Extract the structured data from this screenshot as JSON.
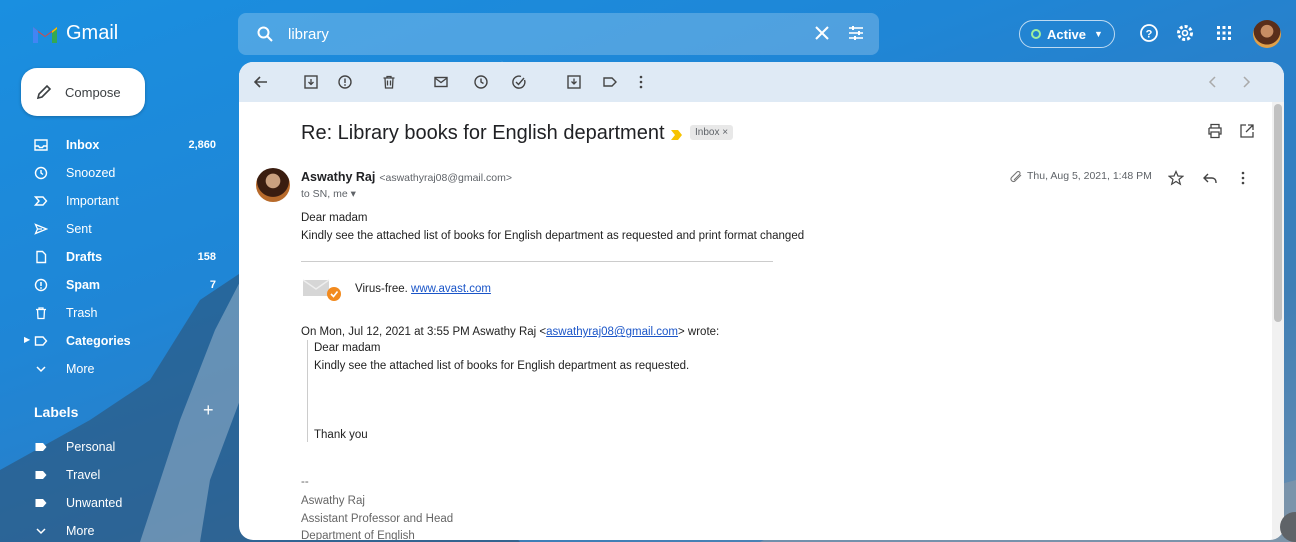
{
  "app": {
    "name": "Gmail"
  },
  "search": {
    "value": "library"
  },
  "status": {
    "label": "Active"
  },
  "compose": {
    "label": "Compose"
  },
  "sidebar": {
    "items": [
      {
        "label": "Inbox",
        "count": "2,860",
        "icon": "inbox-icon"
      },
      {
        "label": "Snoozed",
        "count": "",
        "icon": "clock-icon"
      },
      {
        "label": "Important",
        "count": "",
        "icon": "important-icon"
      },
      {
        "label": "Sent",
        "count": "",
        "icon": "send-icon"
      },
      {
        "label": "Drafts",
        "count": "158",
        "icon": "draft-icon"
      },
      {
        "label": "Spam",
        "count": "7",
        "icon": "spam-icon"
      },
      {
        "label": "Trash",
        "count": "",
        "icon": "trash-icon"
      },
      {
        "label": "Categories",
        "count": "",
        "icon": "label-icon"
      },
      {
        "label": "More",
        "count": "",
        "icon": "chevron-down-icon"
      }
    ]
  },
  "labels": {
    "heading": "Labels",
    "items": [
      {
        "label": "Personal"
      },
      {
        "label": "Travel"
      },
      {
        "label": "Unwanted"
      },
      {
        "label": "More"
      }
    ]
  },
  "email": {
    "subject": "Re: Library books for English department",
    "inbox_chip": "Inbox ×",
    "sender_name": "Aswathy Raj",
    "sender_email": "<aswathyraj08@gmail.com>",
    "to_line": "to SN, me ▾",
    "date": "Thu, Aug 5, 2021, 1:48 PM",
    "greeting": "Dear madam",
    "body": "Kindly see the attached list of books for English department as requested and print format changed",
    "virus_free": "Virus-free.",
    "avast_link": "www.avast.com",
    "quote_header_pre": "On Mon, Jul 12, 2021 at 3:55 PM Aswathy Raj <",
    "quote_header_link": "aswathyraj08@gmail.com",
    "quote_header_post": "> wrote:",
    "quote_greeting": "Dear madam",
    "quote_body": "Kindly see the attached list of books for English department as requested.",
    "quote_thanks": "Thank you",
    "sig_dash": "--",
    "sig_name": "Aswathy Raj",
    "sig_title": "Assistant Professor and Head",
    "sig_dept": "Department of English"
  },
  "colors": {
    "accent": "#1a73e8",
    "banner": "#dfeaf5",
    "link": "#1a55c8"
  }
}
